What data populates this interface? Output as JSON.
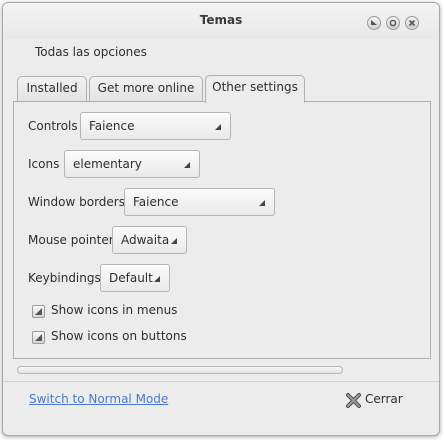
{
  "window": {
    "title": "Temas"
  },
  "menubar": {
    "item": "Todas las opciones"
  },
  "tabs": [
    {
      "label": "Installed"
    },
    {
      "label": "Get more online"
    },
    {
      "label": "Other settings"
    }
  ],
  "settings": {
    "controls": {
      "label": "Controls",
      "value": "Faience"
    },
    "icons": {
      "label": "Icons",
      "value": "elementary"
    },
    "window_borders": {
      "label": "Window borders",
      "value": "Faience"
    },
    "mouse_pointer": {
      "label": "Mouse pointer",
      "value": "Adwaita"
    },
    "keybindings": {
      "label": "Keybindings",
      "value": "Default"
    },
    "show_icons_menus": {
      "label": "Show icons in menus"
    },
    "show_icons_buttons": {
      "label": "Show icons on buttons"
    }
  },
  "footer": {
    "switch_mode": "Switch to Normal Mode",
    "close": "Cerrar"
  },
  "colors": {
    "link": "#4a78c8",
    "background": "#ececec"
  }
}
